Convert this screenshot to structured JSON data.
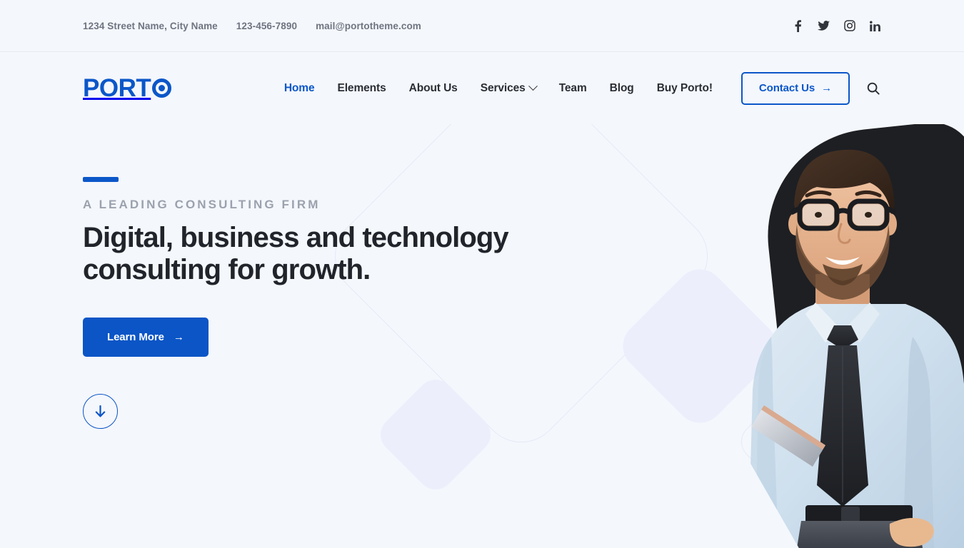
{
  "topbar": {
    "address": "1234 Street Name, City Name",
    "phone": "123-456-7890",
    "email": "mail@portotheme.com",
    "social": [
      {
        "name": "facebook-icon",
        "label": "Facebook"
      },
      {
        "name": "twitter-icon",
        "label": "Twitter"
      },
      {
        "name": "instagram-icon",
        "label": "Instagram"
      },
      {
        "name": "linkedin-icon",
        "label": "LinkedIn"
      }
    ]
  },
  "header": {
    "logo_text": "PORT",
    "logo_alt": "PORTO",
    "nav": [
      {
        "label": "Home",
        "active": true,
        "caret": false
      },
      {
        "label": "Elements",
        "active": false,
        "caret": false
      },
      {
        "label": "About Us",
        "active": false,
        "caret": false
      },
      {
        "label": "Services",
        "active": false,
        "caret": true
      },
      {
        "label": "Team",
        "active": false,
        "caret": false
      },
      {
        "label": "Blog",
        "active": false,
        "caret": false
      },
      {
        "label": "Buy Porto!",
        "active": false,
        "caret": false
      }
    ],
    "contact_label": "Contact Us",
    "contact_arrow": "→",
    "search_icon": "search-icon"
  },
  "hero": {
    "eyebrow": "A LEADING CONSULTING FIRM",
    "headline_line1": "Digital, business and technology",
    "headline_line2": "consulting for growth.",
    "cta_label": "Learn More",
    "cta_arrow": "→",
    "scroll_icon": "arrow-down-icon"
  },
  "colors": {
    "brand_blue": "#0b55c6",
    "page_background": "#f4f7fc",
    "headline_text": "#21242a",
    "eyebrow_text": "#9ba2ad",
    "topbar_text": "#6e7480",
    "decor_fill": "#eceffb",
    "decor_outline": "#e7e9f7",
    "dot_grid": "#c2cddd",
    "dark_shape": "#1d1f23"
  }
}
